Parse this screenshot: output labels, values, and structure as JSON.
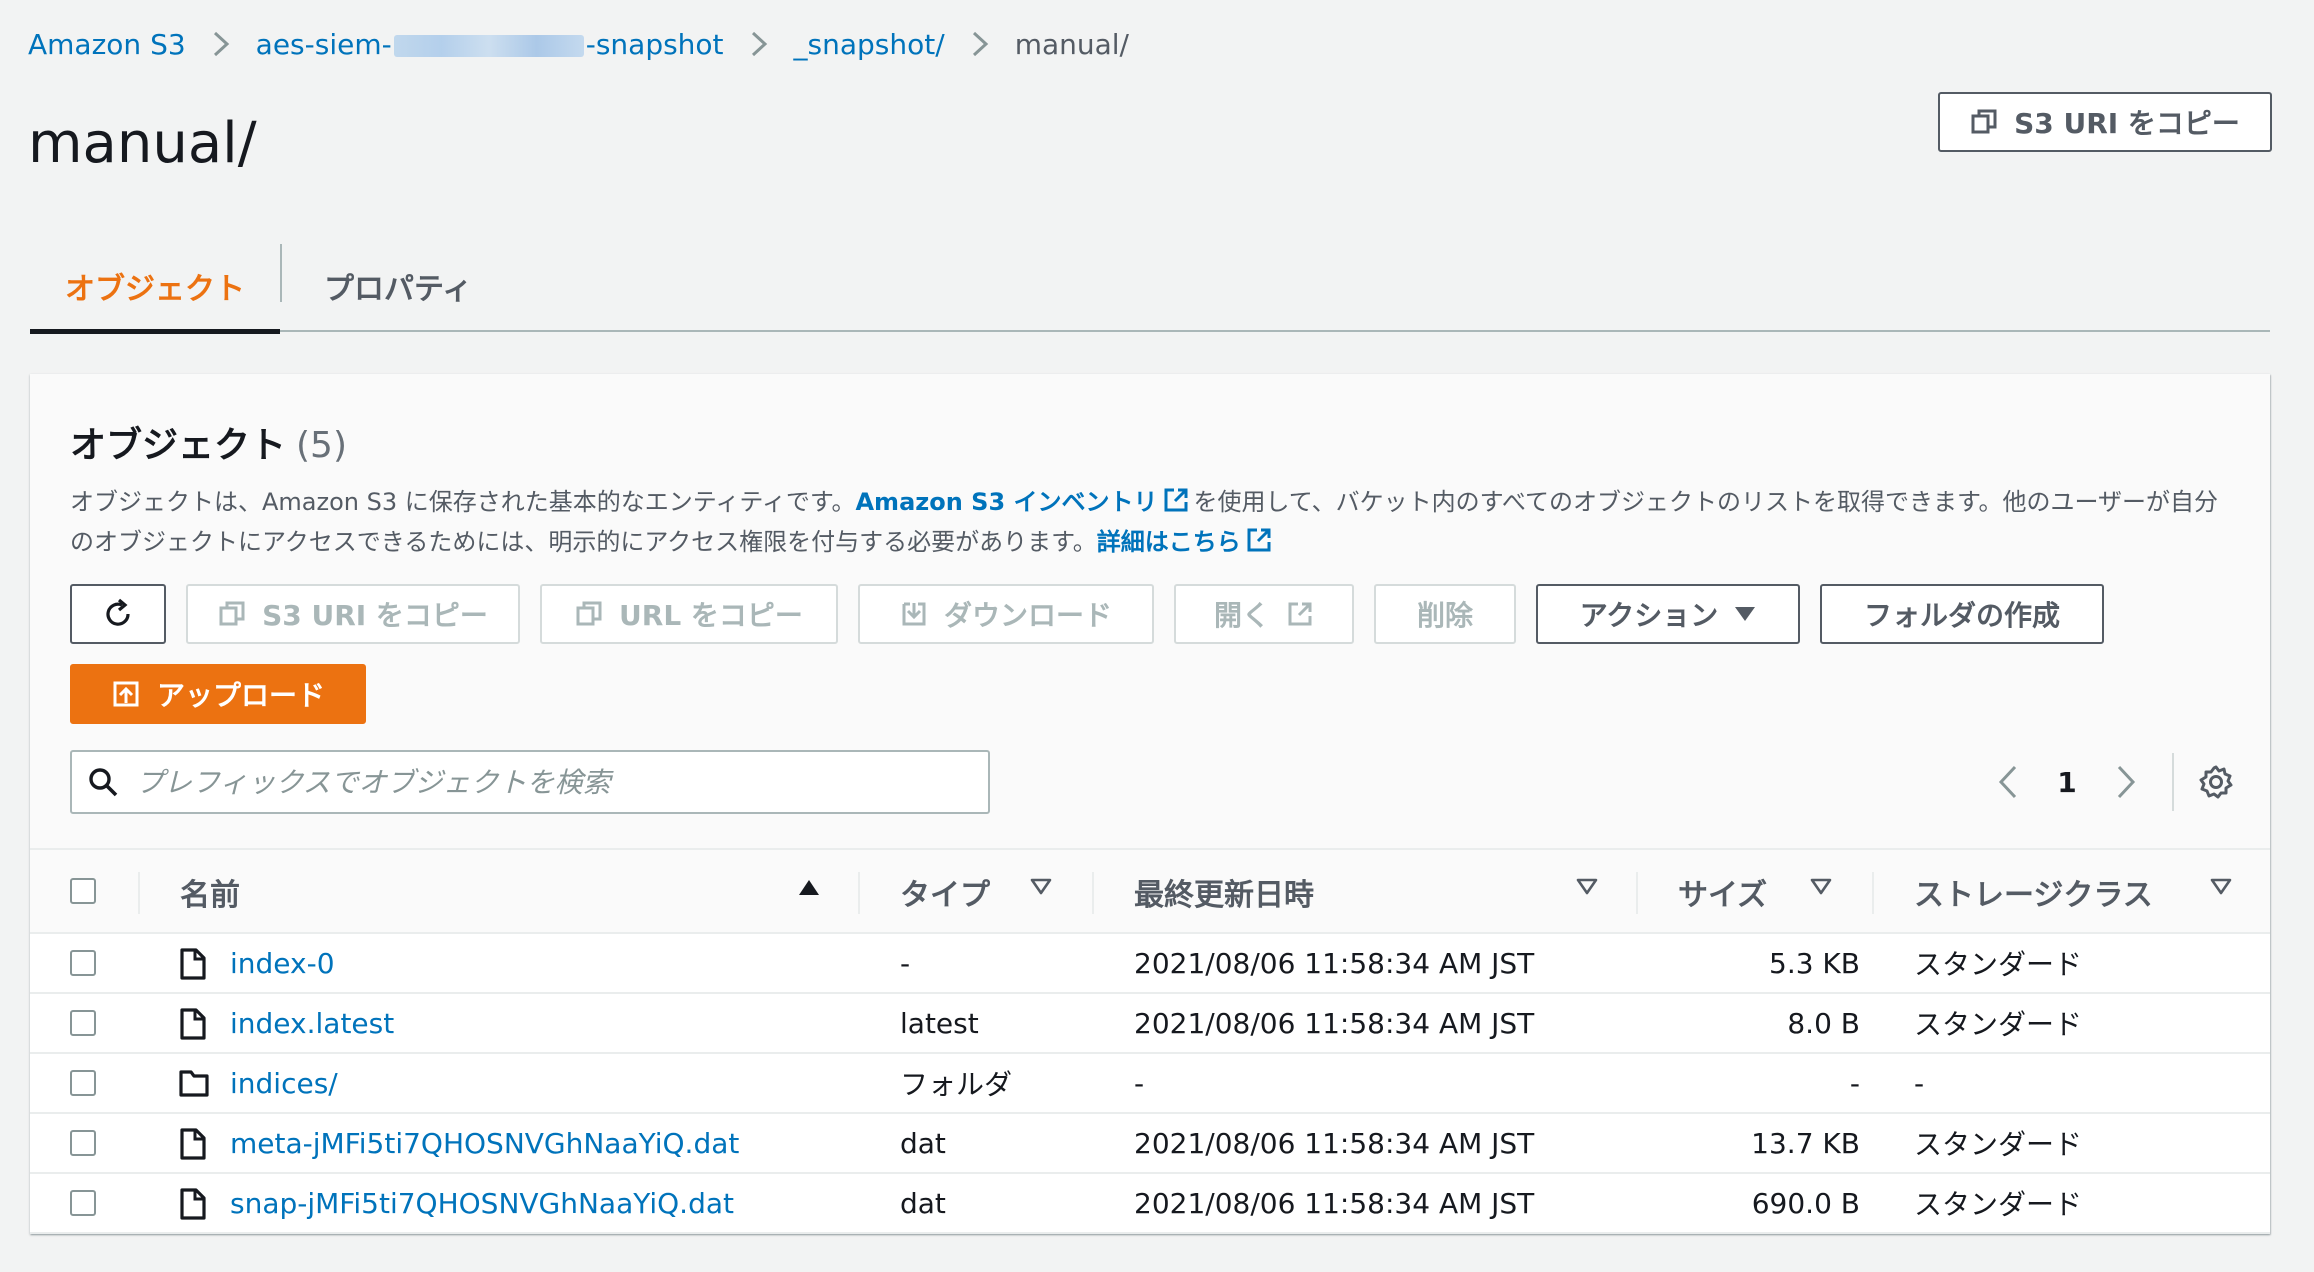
{
  "breadcrumb": {
    "items": [
      "Amazon S3",
      "aes-siem-",
      "-snapshot",
      "_snapshot/",
      "manual/"
    ]
  },
  "page": {
    "title": "manual/",
    "copy_s3_uri_label": "S3 URI をコピー"
  },
  "tabs": [
    "オブジェクト",
    "プロパティ"
  ],
  "objects_panel": {
    "title": "オブジェクト",
    "count": "(5)",
    "desc_part1": "オブジェクトは、Amazon S3 に保存された基本的なエンティティです。",
    "desc_link1": "Amazon S3 インベントリ",
    "desc_part2": "を使用して、バケット内のすべてのオブジェクトのリストを取得できます。他のユーザーが自分のオブジェクトにアクセスできるためには、明示的にアクセス権限を付与する必要があります。",
    "desc_link2": "詳細はこちら"
  },
  "toolbar": {
    "copy_s3_uri": "S3 URI をコピー",
    "copy_url": "URL をコピー",
    "download": "ダウンロード",
    "open": "開く",
    "delete": "削除",
    "actions": "アクション",
    "create_folder": "フォルダの作成",
    "upload": "アップロード"
  },
  "search": {
    "placeholder": "プレフィックスでオブジェクトを検索"
  },
  "pagination": {
    "current_page": "1"
  },
  "table": {
    "headers": [
      "名前",
      "タイプ",
      "最終更新日時",
      "サイズ",
      "ストレージクラス"
    ],
    "rows": [
      {
        "name": "index-0",
        "type": "-",
        "modified": "2021/08/06 11:58:34 AM JST",
        "size": "5.3 KB",
        "storage": "スタンダード",
        "icon": "file-icon"
      },
      {
        "name": "index.latest",
        "type": "latest",
        "modified": "2021/08/06 11:58:34 AM JST",
        "size": "8.0 B",
        "storage": "スタンダード",
        "icon": "file-icon"
      },
      {
        "name": "indices/",
        "type": "フォルダ",
        "modified": "-",
        "size": "-",
        "storage": "-",
        "icon": "folder-icon"
      },
      {
        "name": "meta-jMFi5ti7QHOSNVGhNaaYiQ.dat",
        "type": "dat",
        "modified": "2021/08/06 11:58:34 AM JST",
        "size": "13.7 KB",
        "storage": "スタンダード",
        "icon": "file-icon"
      },
      {
        "name": "snap-jMFi5ti7QHOSNVGhNaaYiQ.dat",
        "type": "dat",
        "modified": "2021/08/06 11:58:34 AM JST",
        "size": "690.0 B",
        "storage": "スタンダード",
        "icon": "file-icon"
      }
    ]
  },
  "colors": {
    "link": "#0073bb",
    "accent": "#ec7211",
    "text": "#16191f",
    "muted": "#545b64"
  }
}
